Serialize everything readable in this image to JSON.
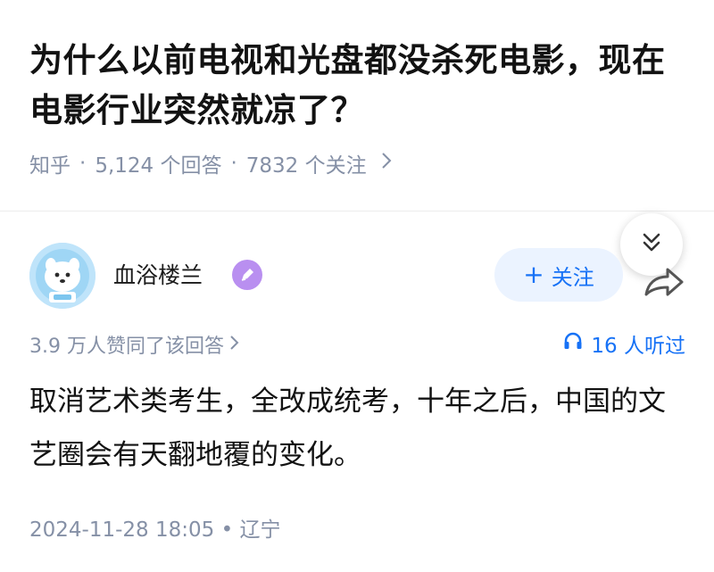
{
  "question": {
    "title": "为什么以前电视和光盘都没杀死电影，现在电影行业突然就凉了？",
    "source": "知乎",
    "answers_count": "5,124 个回答",
    "followers_count": "7832 个关注",
    "separator": "·"
  },
  "answer": {
    "author_name": "血浴楼兰",
    "follow_label": "关注",
    "votes_text": "3.9 万人赞同了该回答",
    "listeners_text": "16 人听过",
    "content": "取消艺术类考生，全改成统考，十年之后，中国的文艺圈会有天翻地覆的变化。",
    "footer": "2024-11-28 18:05 • 辽宁"
  },
  "icons": {
    "collapse": "double-chevron-down-icon",
    "share": "share-arrow-icon",
    "headphones": "headphones-icon",
    "badge": "pen-badge-icon"
  },
  "colors": {
    "accent_blue": "#1772f6",
    "follow_bg": "#ebf3ff",
    "meta_gray": "#8590a6",
    "badge_purple": "#b98ff0"
  }
}
